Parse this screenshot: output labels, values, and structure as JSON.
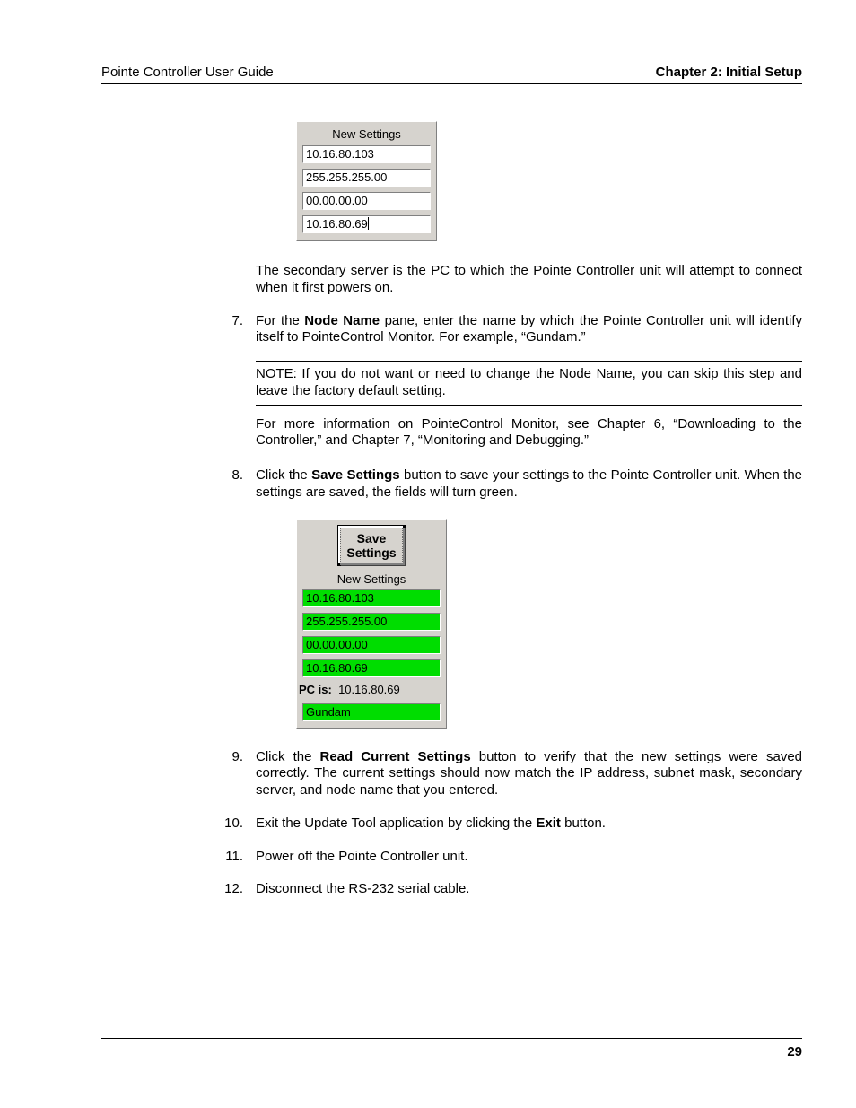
{
  "header": {
    "left": "Pointe Controller User Guide",
    "right": "Chapter 2: Initial Setup"
  },
  "fig1": {
    "title": "New Settings",
    "fields": [
      "10.16.80.103",
      "255.255.255.00",
      "00.00.00.00",
      "10.16.80.69"
    ]
  },
  "para_secondary": "The secondary server is the PC to which the Pointe Controller unit will attempt to connect when it first powers on.",
  "step7": {
    "num": "7.",
    "text_a": "For the ",
    "bold_a": "Node Name",
    "text_b": " pane, enter the name by which the Pointe Controller unit will identify itself to PointeControl Monitor. For example, “Gundam.”",
    "note": "NOTE: If you do not want or need to change the Node Name, you can skip this step and leave the factory default setting.",
    "moreinfo": "For more information on PointeControl Monitor, see Chapter 6, “Downloading to the Controller,” and Chapter 7, “Monitoring and Debugging.”"
  },
  "step8": {
    "num": "8.",
    "text_a": "Click the ",
    "bold_a": "Save Settings",
    "text_b": " button to save your settings to the Pointe Controller unit. When the settings are saved, the fields will turn green."
  },
  "fig2": {
    "button_line1": "Save",
    "button_line2": "Settings",
    "title": "New Settings",
    "fields": [
      "10.16.80.103",
      "255.255.255.00",
      "00.00.00.00",
      "10.16.80.69"
    ],
    "pcis_label": "PC is:",
    "pcis_value": "10.16.80.69",
    "nodename": "Gundam"
  },
  "step9": {
    "num": "9.",
    "text_a": "Click the ",
    "bold_a": "Read Current Settings",
    "text_b": " button to verify that the new settings were saved correctly. The current settings should now match the IP address, subnet mask, secondary server, and node name that you entered."
  },
  "step10": {
    "num": "10.",
    "text_a": "Exit the Update Tool application by clicking the ",
    "bold_a": "Exit",
    "text_b": " button."
  },
  "step11": {
    "num": "11.",
    "text": "Power off the Pointe Controller unit."
  },
  "step12": {
    "num": "12.",
    "text": "Disconnect the RS-232 serial cable."
  },
  "page_number": "29"
}
